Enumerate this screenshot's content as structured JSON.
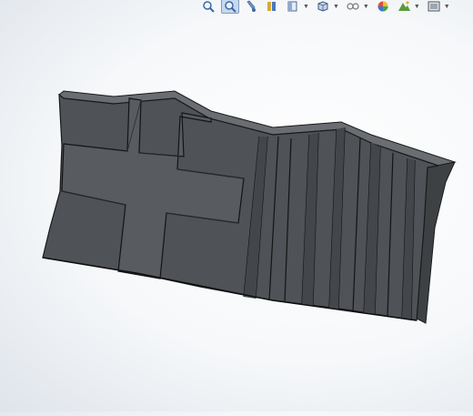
{
  "toolbar": {
    "items": [
      {
        "icon": "zoom-to-fit-icon",
        "has_dropdown": false
      },
      {
        "icon": "zoom-to-area-icon",
        "has_dropdown": false,
        "active": true
      },
      {
        "icon": "previous-view-icon",
        "has_dropdown": false
      },
      {
        "icon": "section-view-icon",
        "has_dropdown": false
      },
      {
        "icon": "view-orientation-icon",
        "has_dropdown": true
      },
      {
        "icon": "display-style-icon",
        "has_dropdown": true
      },
      {
        "icon": "hide-show-items-icon",
        "has_dropdown": true
      },
      {
        "icon": "edit-appearance-icon",
        "has_dropdown": false
      },
      {
        "icon": "apply-scene-icon",
        "has_dropdown": true
      },
      {
        "icon": "view-settings-icon",
        "has_dropdown": true
      }
    ]
  },
  "model": {
    "description_visible": false,
    "face_color": "#4f5256",
    "edge_color": "#1a1a1a",
    "highlight_color": "#6a6d71"
  }
}
